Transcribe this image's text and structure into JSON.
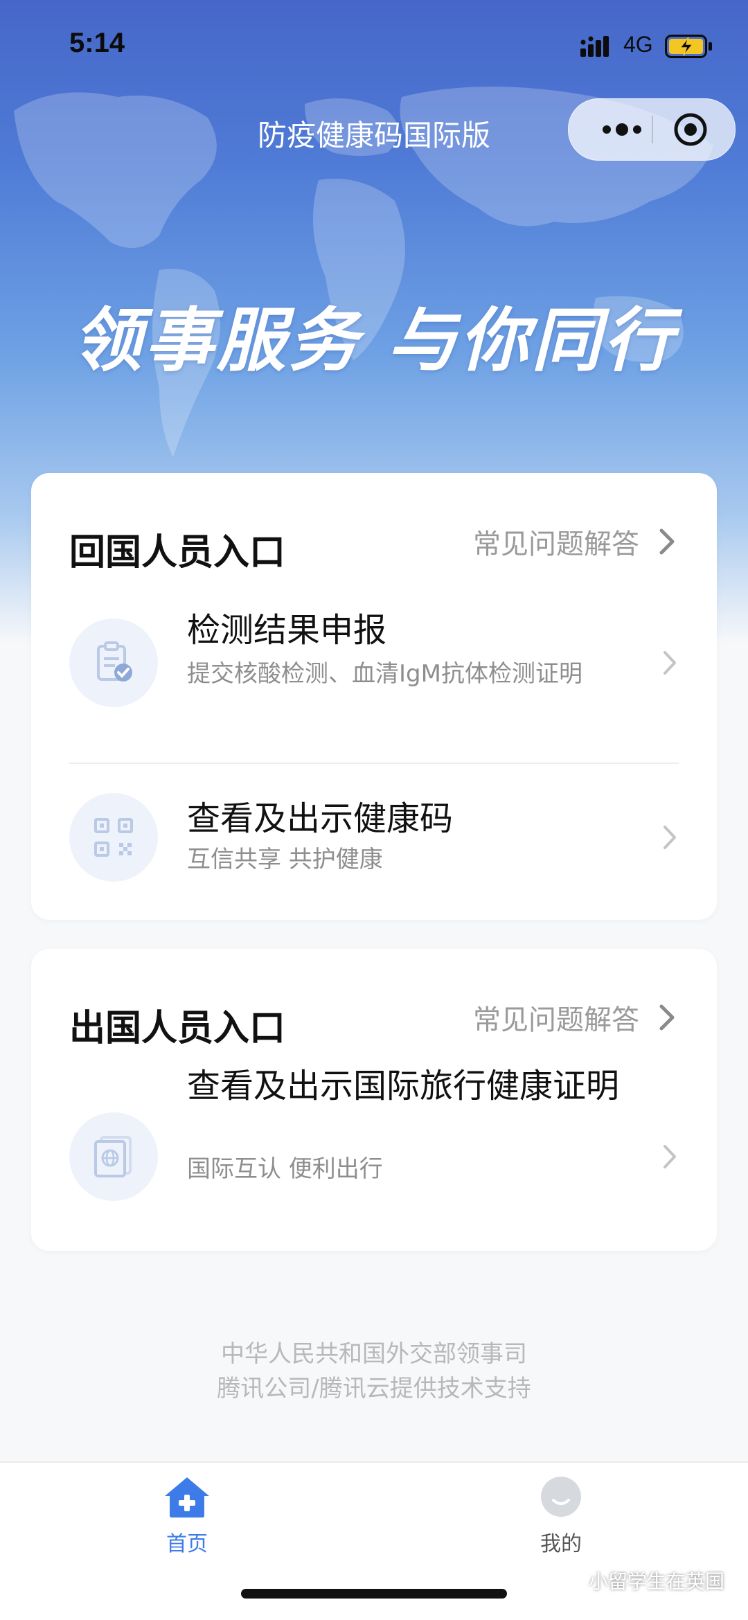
{
  "status_bar": {
    "time": "5:14",
    "network": "4G"
  },
  "nav": {
    "title": "防疫健康码国际版"
  },
  "hero": {
    "slogan": "领事服务 与你同行"
  },
  "return_card": {
    "heading": "回国人员入口",
    "faq_label": "常见问题解答",
    "items": [
      {
        "title": "检测结果申报",
        "subtitle": "提交核酸检测、血清IgM抗体检测证明",
        "icon": "clipboard-check-icon"
      },
      {
        "title": "查看及出示健康码",
        "subtitle": "互信共享 共护健康",
        "icon": "qr-code-icon"
      }
    ]
  },
  "outbound_card": {
    "heading": "出国人员入口",
    "faq_label": "常见问题解答",
    "items": [
      {
        "title": "查看及出示国际旅行健康证明",
        "subtitle": "国际互认 便利出行",
        "icon": "passport-globe-icon"
      }
    ]
  },
  "footer": {
    "line1": "中华人民共和国外交部领事司",
    "line2": "腾讯公司/腾讯云提供技术支持"
  },
  "tabbar": {
    "home_label": "首页",
    "mine_label": "我的",
    "active_color": "#3d7be8",
    "inactive_color": "#555555"
  },
  "watermark": {
    "text": "小留学生在英国"
  },
  "colors": {
    "accent": "#3d7be8",
    "hero_top": "#4667c9"
  }
}
